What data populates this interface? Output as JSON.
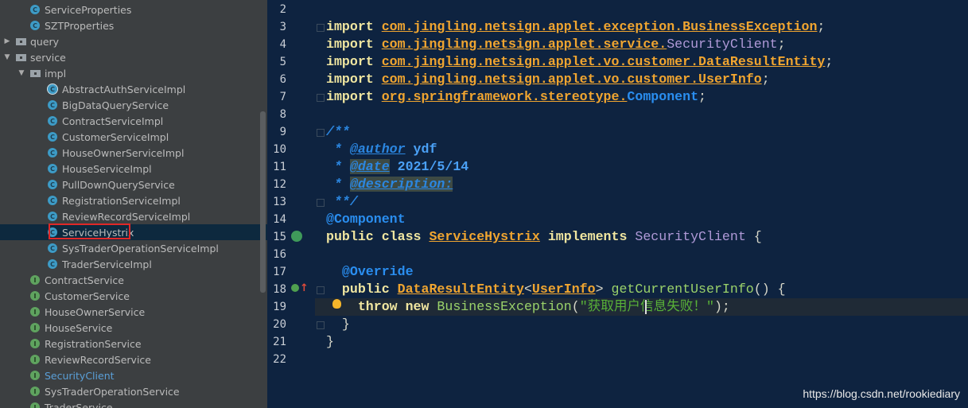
{
  "sidebar": {
    "items": [
      {
        "label": "ServiceProperties",
        "type": "class",
        "indent": 2
      },
      {
        "label": "SZTProperties",
        "type": "class",
        "indent": 2
      },
      {
        "label": "query",
        "type": "folder",
        "indent": 0,
        "arrow": "▶"
      },
      {
        "label": "service",
        "type": "folder",
        "indent": 0,
        "arrow": "▼"
      },
      {
        "label": "impl",
        "type": "folder",
        "indent": 1,
        "arrow": "▼"
      },
      {
        "label": "AbstractAuthServiceImpl",
        "type": "abstract",
        "indent": 3
      },
      {
        "label": "BigDataQueryService",
        "type": "class",
        "indent": 3
      },
      {
        "label": "ContractServiceImpl",
        "type": "class",
        "indent": 3
      },
      {
        "label": "CustomerServiceImpl",
        "type": "class",
        "indent": 3
      },
      {
        "label": "HouseOwnerServiceImpl",
        "type": "class",
        "indent": 3
      },
      {
        "label": "HouseServiceImpl",
        "type": "class",
        "indent": 3
      },
      {
        "label": "PullDownQueryService",
        "type": "class",
        "indent": 3
      },
      {
        "label": "RegistrationServiceImpl",
        "type": "class",
        "indent": 3
      },
      {
        "label": "ReviewRecordServiceImpl",
        "type": "class",
        "indent": 3
      },
      {
        "label": "ServiceHystrix",
        "type": "class",
        "indent": 3,
        "selected": true
      },
      {
        "label": "SysTraderOperationServiceImpl",
        "type": "class",
        "indent": 3
      },
      {
        "label": "TraderServiceImpl",
        "type": "class",
        "indent": 3
      },
      {
        "label": "ContractService",
        "type": "interface",
        "indent": 2
      },
      {
        "label": "CustomerService",
        "type": "interface",
        "indent": 2
      },
      {
        "label": "HouseOwnerService",
        "type": "interface",
        "indent": 2
      },
      {
        "label": "HouseService",
        "type": "interface",
        "indent": 2
      },
      {
        "label": "RegistrationService",
        "type": "interface",
        "indent": 2
      },
      {
        "label": "ReviewRecordService",
        "type": "interface",
        "indent": 2
      },
      {
        "label": "SecurityClient",
        "type": "interface",
        "indent": 2,
        "link": true
      },
      {
        "label": "SysTraderOperationService",
        "type": "interface",
        "indent": 2
      },
      {
        "label": "TraderService",
        "type": "interface",
        "indent": 2
      }
    ]
  },
  "editor": {
    "current_line": 19,
    "lines": [
      {
        "n": "2",
        "tokens": []
      },
      {
        "n": "3",
        "tokens": [
          [
            "import ",
            "kw"
          ],
          [
            "com.jingling.netsign.applet.exception.BusinessException",
            "pkg"
          ],
          [
            ";",
            "plain"
          ]
        ]
      },
      {
        "n": "4",
        "tokens": [
          [
            "import ",
            "kw"
          ],
          [
            "com.jingling.netsign.applet.service.",
            "pkg"
          ],
          [
            "SecurityClient",
            "purple"
          ],
          [
            ";",
            "plain"
          ]
        ]
      },
      {
        "n": "5",
        "tokens": [
          [
            "import ",
            "kw"
          ],
          [
            "com.jingling.netsign.applet.vo.customer.DataResultEntity",
            "pkg"
          ],
          [
            ";",
            "plain"
          ]
        ]
      },
      {
        "n": "6",
        "tokens": [
          [
            "import ",
            "kw"
          ],
          [
            "com.jingling.netsign.applet.vo.customer.UserInfo",
            "pkg"
          ],
          [
            ";",
            "plain"
          ]
        ]
      },
      {
        "n": "7",
        "tokens": [
          [
            "import ",
            "kw"
          ],
          [
            "org.springframework.stereotype.",
            "pkg"
          ],
          [
            "Component",
            "blue"
          ],
          [
            ";",
            "plain"
          ]
        ]
      },
      {
        "n": "8",
        "tokens": []
      },
      {
        "n": "9",
        "tokens": [
          [
            "/**",
            "doc"
          ]
        ]
      },
      {
        "n": "10",
        "tokens": [
          [
            " * ",
            "doc"
          ],
          [
            "@author",
            "docu"
          ],
          [
            " ydf",
            "docb"
          ]
        ]
      },
      {
        "n": "11",
        "tokens": [
          [
            " * ",
            "doc"
          ],
          [
            "@date",
            "dochl"
          ],
          [
            " 2021/5/14",
            "docb"
          ]
        ]
      },
      {
        "n": "12",
        "tokens": [
          [
            " * ",
            "doc"
          ],
          [
            "@description:",
            "dochl"
          ]
        ]
      },
      {
        "n": "13",
        "tokens": [
          [
            " **/",
            "doc"
          ]
        ]
      },
      {
        "n": "14",
        "tokens": [
          [
            "@Component",
            "blue"
          ]
        ]
      },
      {
        "n": "15",
        "tokens": [
          [
            "public class ",
            "kw"
          ],
          [
            "ServiceHystrix",
            "cls"
          ],
          [
            " implements ",
            "kw"
          ],
          [
            "SecurityClient",
            "purple"
          ],
          [
            " {",
            "plain"
          ]
        ]
      },
      {
        "n": "16",
        "tokens": []
      },
      {
        "n": "17",
        "tokens": [
          [
            "  @Override",
            "blue"
          ]
        ]
      },
      {
        "n": "18",
        "tokens": [
          [
            "  public ",
            "kw"
          ],
          [
            "DataResultEntity",
            "cls"
          ],
          [
            "<",
            "plain"
          ],
          [
            "UserInfo",
            "cls"
          ],
          [
            "> ",
            "plain"
          ],
          [
            "getCurrentUserInfo",
            "green"
          ],
          [
            "() {",
            "plain"
          ]
        ]
      },
      {
        "n": "19",
        "tokens": [
          [
            "    throw new ",
            "kw"
          ],
          [
            "BusinessException",
            "green"
          ],
          [
            "(",
            "plain"
          ],
          [
            "\"获取用户信息失败！\"",
            "str"
          ],
          [
            ");",
            "plain"
          ]
        ]
      },
      {
        "n": "20",
        "tokens": [
          [
            "  }",
            "plain"
          ]
        ]
      },
      {
        "n": "21",
        "tokens": [
          [
            "}",
            "plain"
          ]
        ]
      },
      {
        "n": "22",
        "tokens": []
      }
    ]
  },
  "gutter_icons": {
    "line15": "spring-bean-icon",
    "line18": "override-method-icon",
    "line19": "lightbulb-icon"
  },
  "watermark": "https://blog.csdn.net/rookiediary",
  "colors": {
    "editor_bg": "#0e2340",
    "sidebar_bg": "#3c3f41",
    "keyword": "#f0e6a0",
    "package": "#f0a530",
    "string": "#58b038",
    "selection_box": "#e02828"
  }
}
